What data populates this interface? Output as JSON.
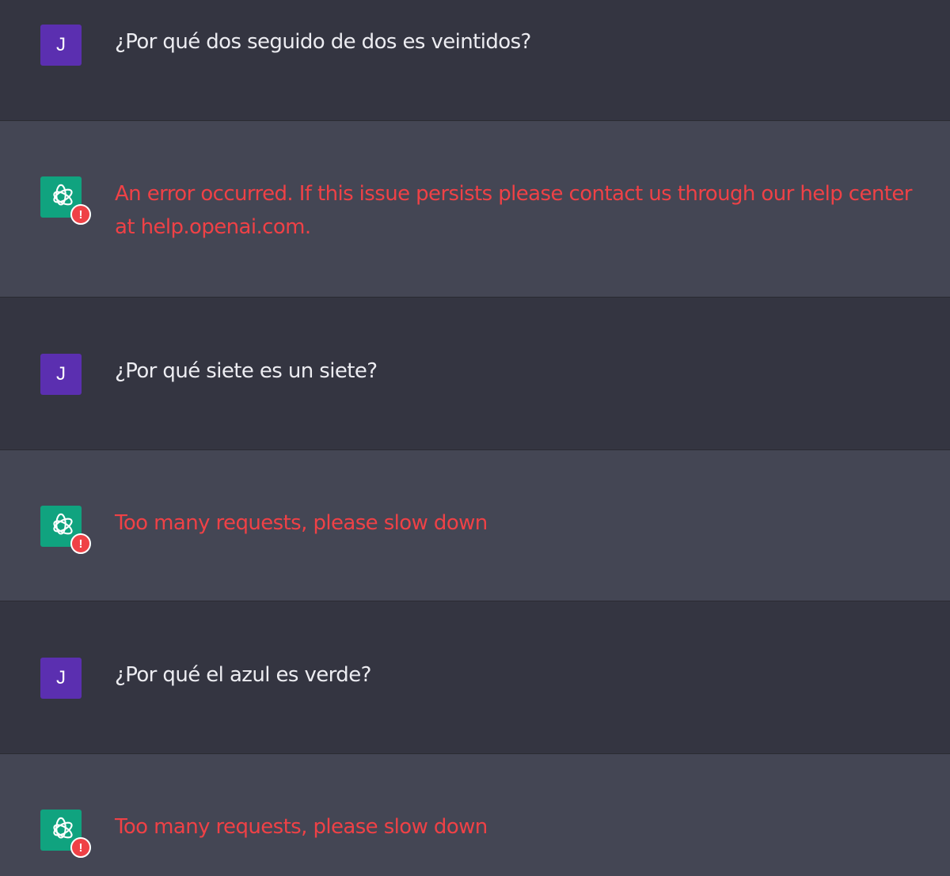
{
  "colors": {
    "user_bg": "#343541",
    "assistant_bg": "#444654",
    "user_avatar": "#5b2fb0",
    "assistant_avatar": "#10a37f",
    "error_text": "#ef4146"
  },
  "messages": [
    {
      "role": "user",
      "avatar_letter": "J",
      "text": "¿Por qué dos seguido de dos es veintidos?"
    },
    {
      "role": "assistant",
      "avatar_icon": "openai-logo-icon",
      "badge": "!",
      "error": true,
      "text": "An error occurred. If this issue persists please contact us through our help center at help.openai.com."
    },
    {
      "role": "user",
      "avatar_letter": "J",
      "text": "¿Por qué siete es un siete?"
    },
    {
      "role": "assistant",
      "avatar_icon": "openai-logo-icon",
      "badge": "!",
      "error": true,
      "text": "Too many requests, please slow down"
    },
    {
      "role": "user",
      "avatar_letter": "J",
      "text": "¿Por qué el azul es verde?"
    },
    {
      "role": "assistant",
      "avatar_icon": "openai-logo-icon",
      "badge": "!",
      "error": true,
      "text": "Too many requests, please slow down"
    }
  ]
}
